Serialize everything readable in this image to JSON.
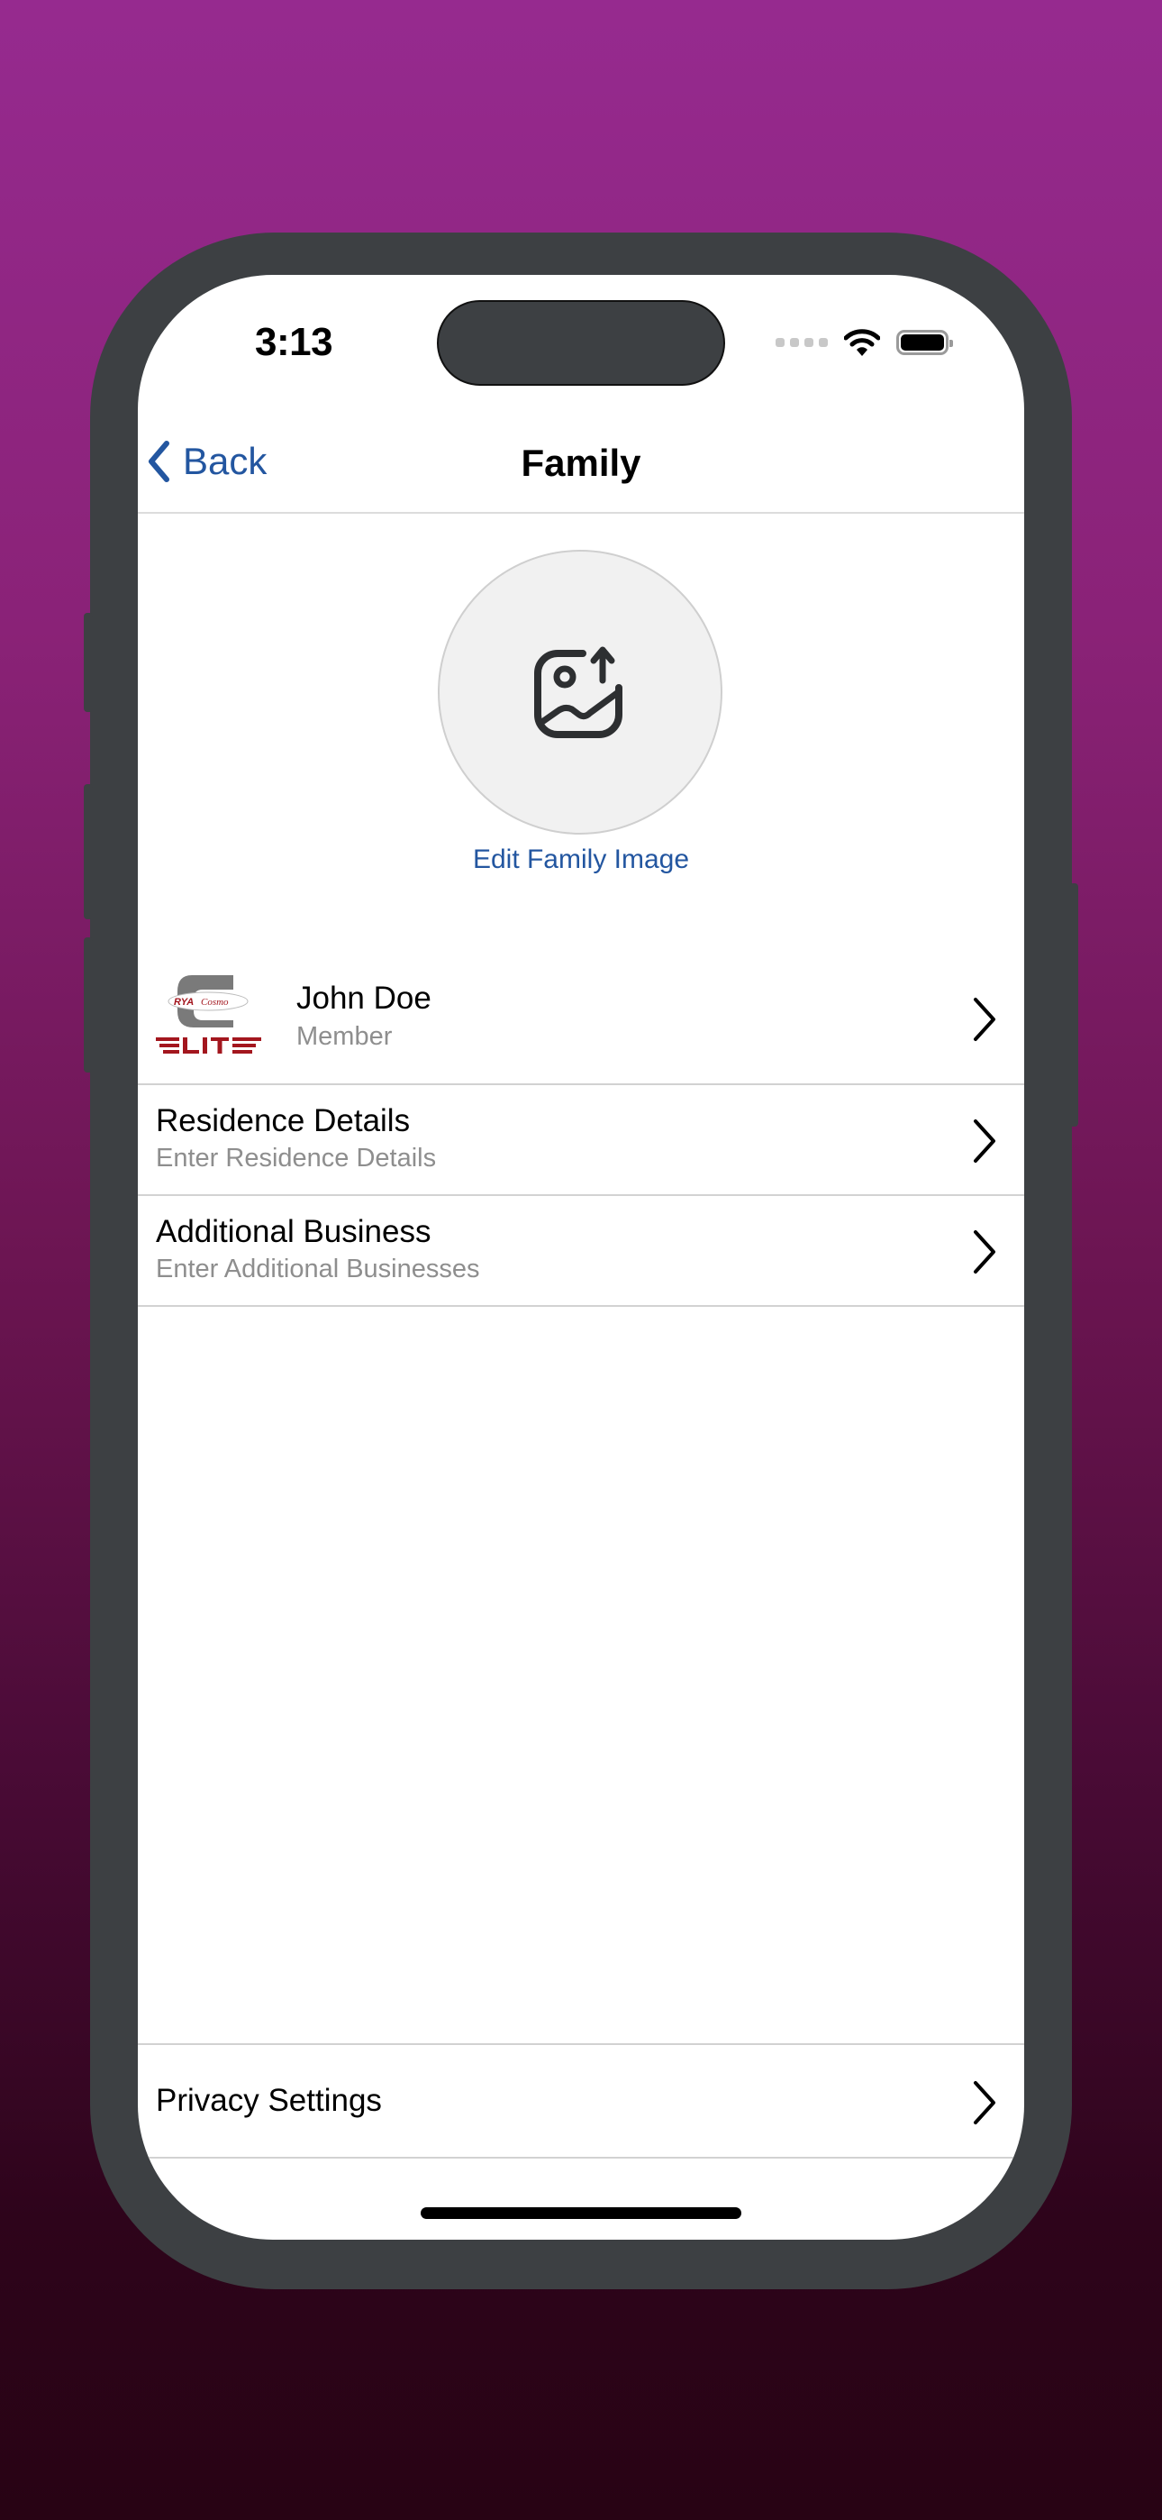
{
  "status_bar": {
    "time": "3:13",
    "signal_icon": "cellular-signal-icon",
    "wifi_icon": "wifi-icon",
    "battery_icon": "battery-full-icon"
  },
  "nav": {
    "back_label": "Back",
    "back_icon": "chevron-left-icon",
    "title": "Family"
  },
  "family_image": {
    "icon": "image-upload-icon",
    "edit_label": "Edit Family Image"
  },
  "members": [
    {
      "name": "John Doe",
      "role": "Member",
      "logo": {
        "brand_top_left": "RYA",
        "brand_top_right": "Cosmo",
        "brand_bottom": "ELITE"
      }
    }
  ],
  "detail_rows": [
    {
      "title": "Residence Details",
      "subtitle": "Enter Residence Details"
    },
    {
      "title": "Additional Business",
      "subtitle": "Enter Additional Businesses"
    }
  ],
  "footer_rows": [
    {
      "title": "Privacy Settings"
    }
  ],
  "colors": {
    "accent": "#2356a0",
    "logo_red": "#a3161e",
    "logo_gray": "#7a7a7a",
    "frame": "#3d4043",
    "subtitle": "#8e8e8e",
    "separator": "#d2d2d2"
  }
}
